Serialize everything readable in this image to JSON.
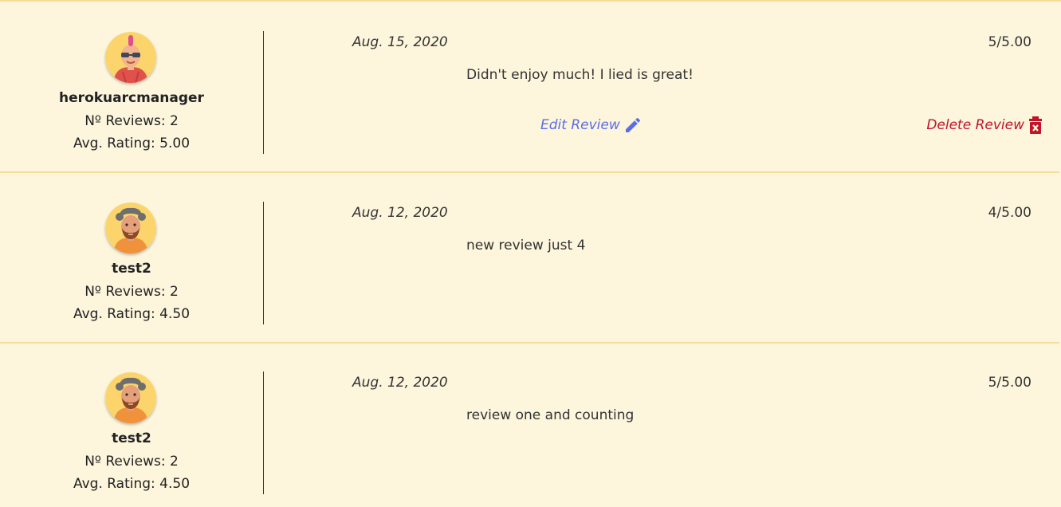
{
  "colors": {
    "background": "#fdf5dc",
    "separator": "#f5df97",
    "edit": "#5b6ee8",
    "delete": "#c0142b"
  },
  "reviews": [
    {
      "username": "herokuarcmanager",
      "review_count": "Nº Reviews: 2",
      "avg_rating": "Avg. Rating: 5.00",
      "date": "Aug. 15, 2020",
      "score": "5/5.00",
      "comment": "Didn't enjoy much! I lied is great!",
      "edit_label": "Edit Review",
      "delete_label": "Delete Review",
      "avatar": "punk-avatar-icon"
    },
    {
      "username": "test2",
      "review_count": "Nº Reviews: 2",
      "avg_rating": "Avg. Rating: 4.50",
      "date": "Aug. 12, 2020",
      "score": "4/5.00",
      "comment": "new review just 4",
      "avatar": "bearded-avatar-icon"
    },
    {
      "username": "test2",
      "review_count": "Nº Reviews: 2",
      "avg_rating": "Avg. Rating: 4.50",
      "date": "Aug. 12, 2020",
      "score": "5/5.00",
      "comment": "review one and counting",
      "avatar": "bearded-avatar-icon"
    }
  ]
}
